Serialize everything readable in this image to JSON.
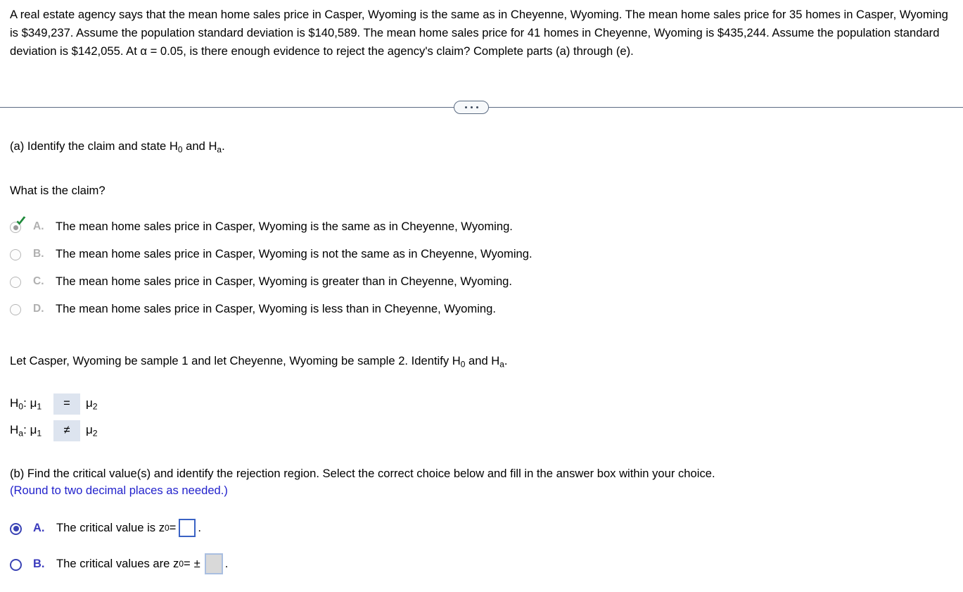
{
  "problem": {
    "statement": "A real estate agency says that the mean home sales price in Casper, Wyoming is the same as in Cheyenne, Wyoming. The mean home sales price for 35 homes in Casper, Wyoming is $349,237. Assume the population standard deviation is $140,589. The mean home sales price for 41 homes in Cheyenne, Wyoming is $435,244. Assume the population standard deviation is $142,055. At α = 0.05, is there enough evidence to reject the agency's claim? Complete parts (a) through (e)."
  },
  "divider": {
    "expand_icon": "ellipsis-icon",
    "dots": [
      "•",
      "•",
      "•"
    ]
  },
  "part_a": {
    "prompt_prefix": "(a) Identify the claim and state H",
    "prompt_sub_0": "0",
    "prompt_mid": " and H",
    "prompt_sub_a": "a",
    "prompt_suffix": ".",
    "question": "What is the claim?",
    "choices": [
      {
        "letter": "A.",
        "text": "The mean home sales price in Casper, Wyoming is the same as in Cheyenne, Wyoming.",
        "selected": true,
        "correct": true
      },
      {
        "letter": "B.",
        "text": "The mean home sales price in Casper, Wyoming is not the same as in Cheyenne, Wyoming.",
        "selected": false,
        "correct": false
      },
      {
        "letter": "C.",
        "text": "The mean home sales price in Casper, Wyoming is greater than in Cheyenne, Wyoming.",
        "selected": false,
        "correct": false
      },
      {
        "letter": "D.",
        "text": "The mean home sales price in Casper, Wyoming is less than in Cheyenne, Wyoming.",
        "selected": false,
        "correct": false
      }
    ],
    "sample_sentence_prefix": "Let Casper, Wyoming be sample 1 and let Cheyenne, Wyoming be sample 2. Identify H",
    "sample_sentence_sub_0": "0",
    "sample_sentence_mid": " and H",
    "sample_sentence_sub_a": "a",
    "sample_sentence_suffix": ".",
    "hypotheses": [
      {
        "name": "H",
        "name_sub": "0",
        "colon": ":",
        "mu_left": "μ",
        "mu_left_sub": "1",
        "operator": "=",
        "mu_right": "μ",
        "mu_right_sub": "2"
      },
      {
        "name": "H",
        "name_sub": "a",
        "colon": ":",
        "mu_left": "μ",
        "mu_left_sub": "1",
        "operator": "≠",
        "mu_right": "μ",
        "mu_right_sub": "2"
      }
    ]
  },
  "part_b": {
    "prompt": "(b) Find the critical value(s) and identify the rejection region. Select the correct choice below and fill in the answer box within your choice.",
    "round_note": "(Round to two decimal places as needed.)",
    "choices": [
      {
        "letter": "A.",
        "text_before": "The critical value is z",
        "sub": "0",
        "equals": " = ",
        "plus_minus": "",
        "value": "",
        "trailing": ".",
        "selected": true,
        "box_enabled": true
      },
      {
        "letter": "B.",
        "text_before": "The critical values are z",
        "sub": "0",
        "equals": " = ",
        "plus_minus": "±",
        "value": "",
        "trailing": ".",
        "selected": false,
        "box_enabled": false
      }
    ]
  },
  "colors": {
    "blue_note": "#2222cc",
    "radio_blue": "#3b44b5",
    "answer_box_border": "#3a62c4",
    "check_green": "#1f8a3b",
    "operator_box_bg": "#dde4ef",
    "divider": "#5b6b82",
    "dim_letter": "#b0b0b0"
  }
}
